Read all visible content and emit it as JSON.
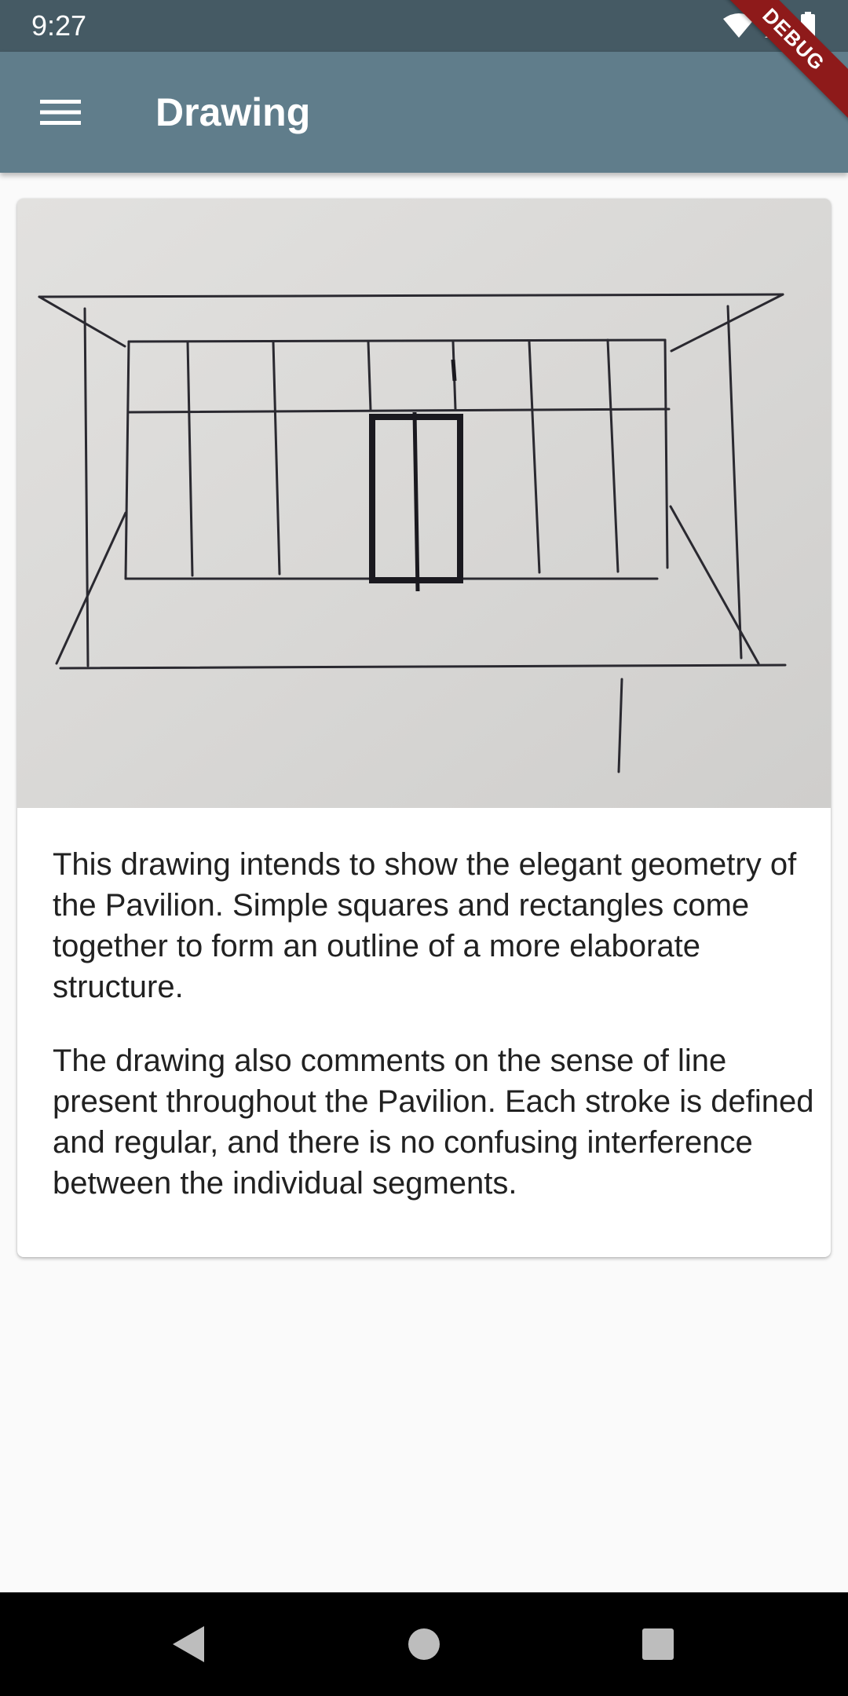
{
  "status_bar": {
    "time": "9:27",
    "icons": [
      "wifi-icon",
      "signal-icon",
      "battery-icon"
    ]
  },
  "debug_banner": "DEBUG",
  "app_bar": {
    "menu_icon": "menu-icon",
    "title": "Drawing"
  },
  "card": {
    "image_description": "hand-drawn-pavilion-sketch",
    "paragraphs": [
      "This drawing intends to show the elegant geometry of the Pavilion. Simple squares and rectangles come together to form an outline of a more elaborate structure.",
      "The drawing also comments on the sense of line present throughout the Pavilion. Each stroke is defined and regular, and there is no confusing interference between the individual segments."
    ]
  },
  "nav_bar": {
    "buttons": [
      "back-icon",
      "home-icon",
      "recents-icon"
    ]
  },
  "colors": {
    "status_bar": "#455a64",
    "app_bar": "#607d8b",
    "debug_banner": "#8e1a1a",
    "background": "#fafafa"
  }
}
